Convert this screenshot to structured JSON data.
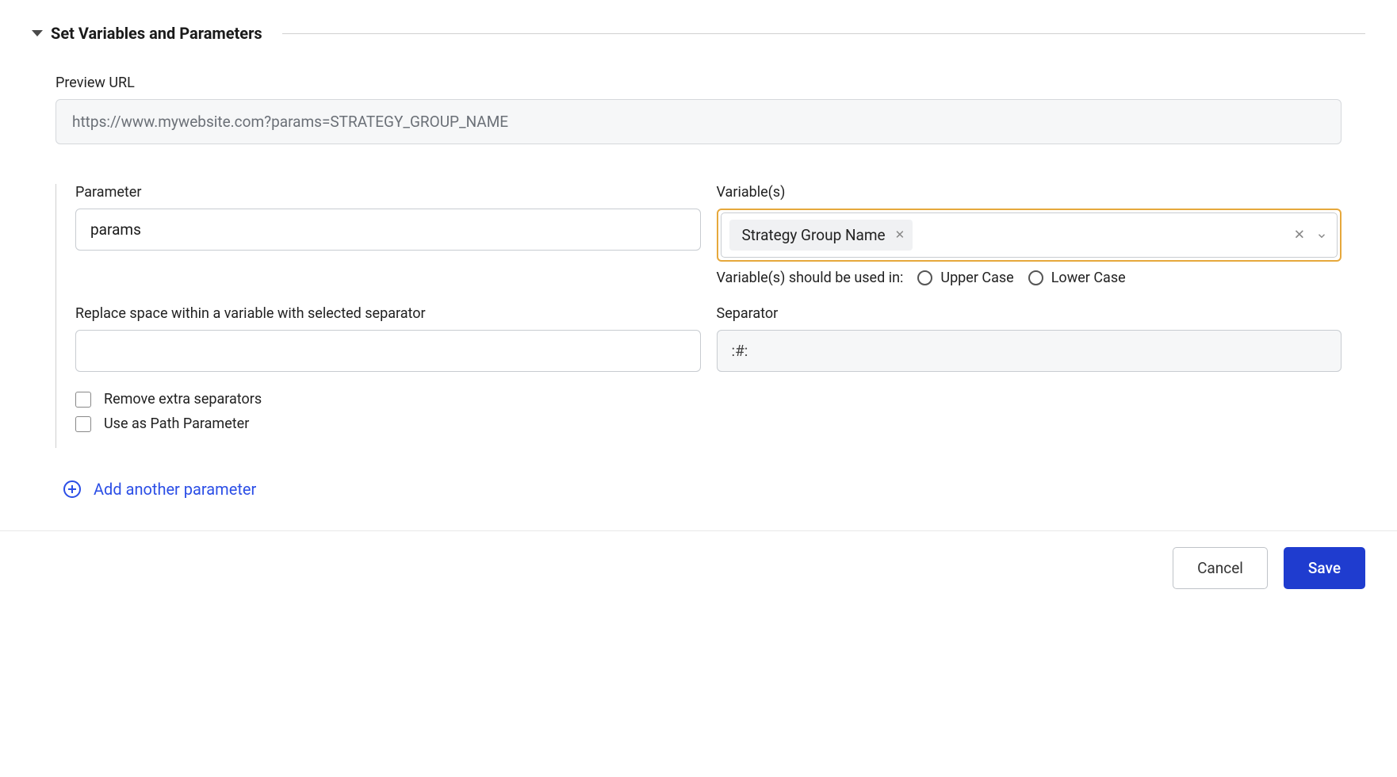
{
  "section": {
    "title": "Set Variables and Parameters"
  },
  "preview": {
    "label": "Preview URL",
    "value": "https://www.mywebsite.com?params=STRATEGY_GROUP_NAME"
  },
  "parameter": {
    "label": "Parameter",
    "value": "params"
  },
  "variables": {
    "label": "Variable(s)",
    "selected": [
      {
        "label": "Strategy Group Name"
      }
    ],
    "case_prompt": "Variable(s) should be used in:",
    "upper": "Upper Case",
    "lower": "Lower Case"
  },
  "replace_space": {
    "label": "Replace space within a variable with selected separator",
    "value": ""
  },
  "separator": {
    "label": "Separator",
    "value": ":#:"
  },
  "checkboxes": {
    "remove_extra": "Remove extra separators",
    "path_param": "Use as Path Parameter"
  },
  "add_link": "Add another parameter",
  "footer": {
    "cancel": "Cancel",
    "save": "Save"
  }
}
